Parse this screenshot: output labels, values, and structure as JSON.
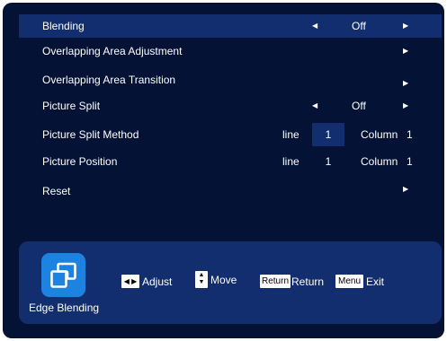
{
  "menu": {
    "items": [
      {
        "label": "Blending",
        "value": "Off",
        "has_left_arrow": true,
        "has_right_arrow": true,
        "selected": true
      },
      {
        "label": "Overlapping Area Adjustment",
        "has_right_arrow": true
      },
      {
        "label": "Overlapping Area Transition",
        "has_right_arrow": true
      },
      {
        "label": "Picture Split",
        "value": "Off",
        "has_left_arrow": true,
        "has_right_arrow": true
      },
      {
        "label": "Picture Split Method",
        "line_label": "line",
        "line_value": "1",
        "column_label": "Column",
        "column_value": "1"
      },
      {
        "label": "Picture Position",
        "line_label": "line",
        "line_value": "1",
        "column_label": "Column",
        "column_value": "1"
      },
      {
        "label": "Reset",
        "has_right_arrow": true
      }
    ]
  },
  "footer": {
    "app_name": "Edge Blending",
    "app_icon": "edge-blending-icon",
    "hints": {
      "adjust_label": "Adjust",
      "move_label": "Move",
      "return_key": "Return",
      "return_label": "Return",
      "menu_key": "Menu",
      "exit_label": "Exit"
    }
  },
  "colors": {
    "background": "#031235",
    "panel": "#132e6e",
    "icon_blue": "#1c84e0",
    "text": "#ffffff"
  }
}
